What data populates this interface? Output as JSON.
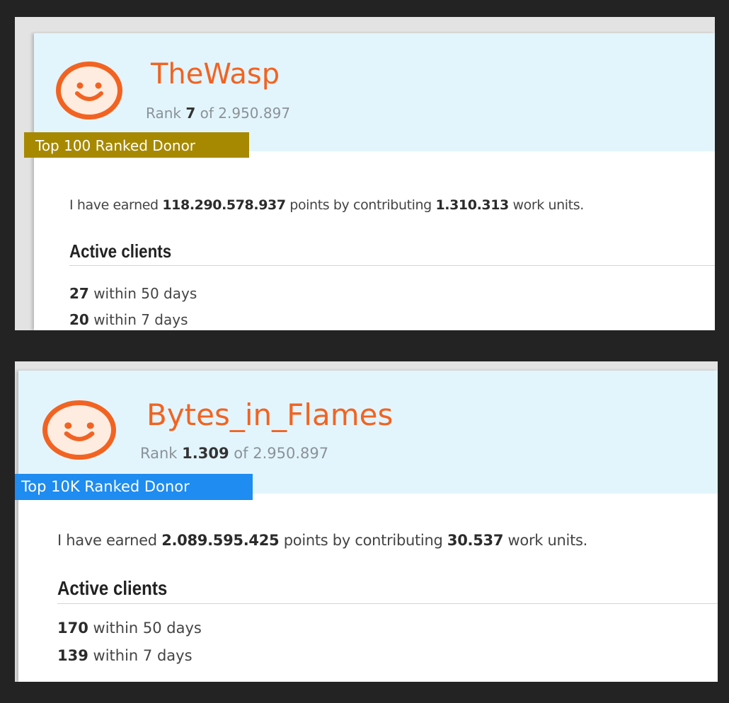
{
  "donors": [
    {
      "name": "TheWasp",
      "rank_label": "Rank",
      "rank": "7",
      "rank_of": "of 2.950.897",
      "badge": "Top 100 Ranked Donor",
      "badge_color": "#a68900",
      "earned_prefix": "I have earned",
      "points": "118.290.578.937",
      "earned_mid": "points by contributing",
      "work_units": "1.310.313",
      "earned_suffix": "work units.",
      "active_clients_title": "Active clients",
      "clients": [
        {
          "count": "27",
          "label": "within 50 days"
        },
        {
          "count": "20",
          "label": "within 7 days"
        }
      ]
    },
    {
      "name": "Bytes_in_Flames",
      "rank_label": "Rank",
      "rank": "1.309",
      "rank_of": "of 2.950.897",
      "badge": "Top 10K Ranked Donor",
      "badge_color": "#1e8cf0",
      "earned_prefix": "I have earned",
      "points": "2.089.595.425",
      "earned_mid": "points by contributing",
      "work_units": "30.537",
      "earned_suffix": "work units.",
      "active_clients_title": "Active clients",
      "clients": [
        {
          "count": "170",
          "label": "within 50 days"
        },
        {
          "count": "139",
          "label": "within 7 days"
        }
      ]
    }
  ],
  "colors": {
    "background": "#232323",
    "accent": "#f26322",
    "header_bg": "#e3f5fc"
  },
  "icons": [
    "smiley-avatar-icon"
  ]
}
